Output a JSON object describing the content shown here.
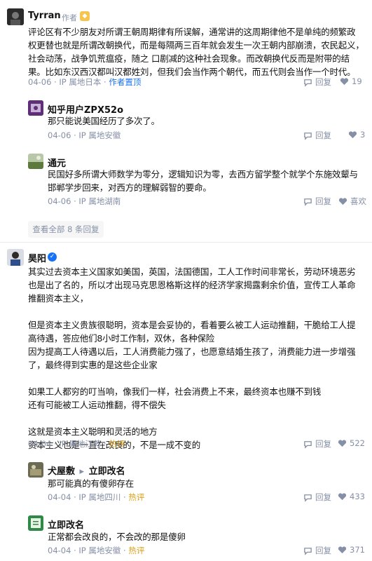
{
  "comments": [
    {
      "name": "Tyrran",
      "tag": "作者",
      "lines": [
        "评论区有不少朋友对所谓王朝周期律有所误解，通常讲的这周期律他不是单纯的频繁政",
        "权更替也就是所谓改朝换代，而是每隔两三百年就会发生一次王朝内部崩溃，农民起义，",
        "社会动荡，战争饥荒瘟疫，随之 口剧减的这种社会现象。而改朝换代反而是附带的结",
        "果。比如东汉西汉都叫汉都姓刘，但我们会当作两个朝代，而五代则会当作一个时代。"
      ],
      "date": "04-06",
      "location": "IP 属地日本",
      "pin": "作者置顶",
      "reply": "回复",
      "likes": "19"
    }
  ],
  "replies_a": [
    {
      "name": "知乎用户ZPX52o",
      "lines": [
        "那只能说美国经历了多次了。"
      ],
      "date": "04-06",
      "location": "IP 属地安徽",
      "reply": "回复",
      "likes": "3"
    },
    {
      "name": "通元",
      "lines": [
        "民国好多所谓大师数学为零分，逻辑知识为零，去西方留学整个就学个东施效颦与",
        "邯郸学步回来，对西方的理解弱智的要命。"
      ],
      "date": "04-06",
      "location": "IP 属地湖南",
      "reply": "回复",
      "likes": "喜欢"
    }
  ],
  "more_replies": "查看全部 8 条回复",
  "main2": {
    "name": "昊阳",
    "lines": [
      "其实过去资本主义国家如美国，英国，法国德国，工人工作时间非常长，劳动环境恶劣",
      "也是出了名的，所以才出现马克思恩格斯这样的经济学家揭露剩余价值，宣传工人革命",
      "推翻资本主义，",
      "",
      "但是资本主义贵族很聪明，资本是会妥协的，看着要么被工人运动推翻，干脆给工人提",
      "高待遇，答应他们8小时工作制，双休，各种保险",
      "因为提高工人待遇以后，工人消费能力强了，也愿意结婚生孩了，消费能力进一步增强",
      "了，最终得到实惠的是这些企业家",
      "",
      "如果工人都穷的叮当响，像我们一样，社会消费上不来，最终资本也赚不到钱",
      "还有可能被工人运动推翻，得不偿失",
      "",
      "这就是资本主义聪明和灵活的地方",
      "资本主义也是一直在改良的，不是一成不变的"
    ],
    "date": "04-04",
    "location": "IP 属地江苏",
    "hot": "热评",
    "reply": "回复",
    "likes": "522"
  },
  "replies_b": [
    {
      "name": "犬屋敷",
      "arrow": "▸",
      "target": "立即改名",
      "lines": [
        "那可能真的有傻卵存在"
      ],
      "date": "04-04",
      "location": "IP 属地四川",
      "hot": "热评",
      "reply": "回复",
      "likes": "433"
    },
    {
      "name": "立即改名",
      "lines": [
        "正常都会改良的，不会改的那是傻卵"
      ],
      "date": "04-04",
      "location": "IP 属地安徽",
      "hot": "热评",
      "reply": "回复",
      "likes": "371"
    }
  ],
  "colors": {
    "accent": "#1772f6",
    "meta": "#8590a6",
    "hot": "#e0a015",
    "text": "#121212"
  }
}
